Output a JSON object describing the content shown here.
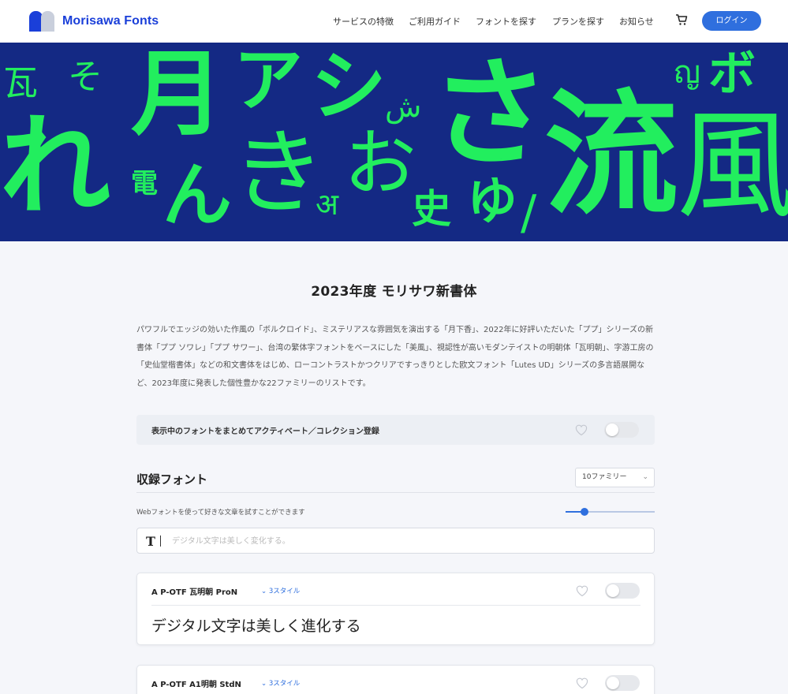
{
  "header": {
    "brand": "Morisawa Fonts",
    "nav": [
      "サービスの特徴",
      "ご利用ガイド",
      "フォントを探す",
      "プランを探す",
      "お知らせ"
    ],
    "login": "ログイン"
  },
  "hero": {
    "glyphs": [
      "瓦",
      "そ",
      "れ",
      "月",
      "電",
      "ん",
      "ア",
      "シ",
      "き",
      "अ",
      "ش",
      "お",
      "史",
      "さ",
      "ゆ",
      "流",
      "ญ",
      "ボ",
      "風"
    ]
  },
  "main": {
    "title": "2023年度 モリサワ新書体",
    "description": "パワフルでエッジの効いた作風の「ボルクロイド」、ミステリアスな雰囲気を演出する「月下香」、2022年に好評いただいた「ププ」シリーズの新書体「ププ ソワレ」「ププ サワー」、台湾の繁体字フォントをベースにした「美風」、視認性が高いモダンテイストの明朝体「瓦明朝」、字游工房の「史仙堂楷書体」などの和文書体をはじめ、ローコントラストかつクリアですっきりとした欧文フォント「Lutes UD」シリーズの多言語展開など、2023年度に発表した個性豊かな22ファミリーのリストです。",
    "activate_label": "表示中のフォントをまとめてアクティベート／コレクション登録",
    "section_title": "収録フォント",
    "family_select": "10ファミリー",
    "hint": "Webフォントを使って好きな文章を試すことができます",
    "slider_level": 0.21,
    "input_placeholder": "デジタル文字は美しく変化する。",
    "t_icon": "T"
  },
  "fonts": [
    {
      "name": "A P-OTF 瓦明朝 ProN",
      "styles": "3スタイル",
      "preview": "デジタル文字は美しく進化する"
    },
    {
      "name": "A P-OTF A1明朝 StdN",
      "styles": "3スタイル",
      "preview": ""
    }
  ],
  "colors": {
    "brand": "#1a3fd9",
    "accent": "#2f6fde",
    "hero_bg": "#142984",
    "hero_glyph": "#22ee5e"
  }
}
